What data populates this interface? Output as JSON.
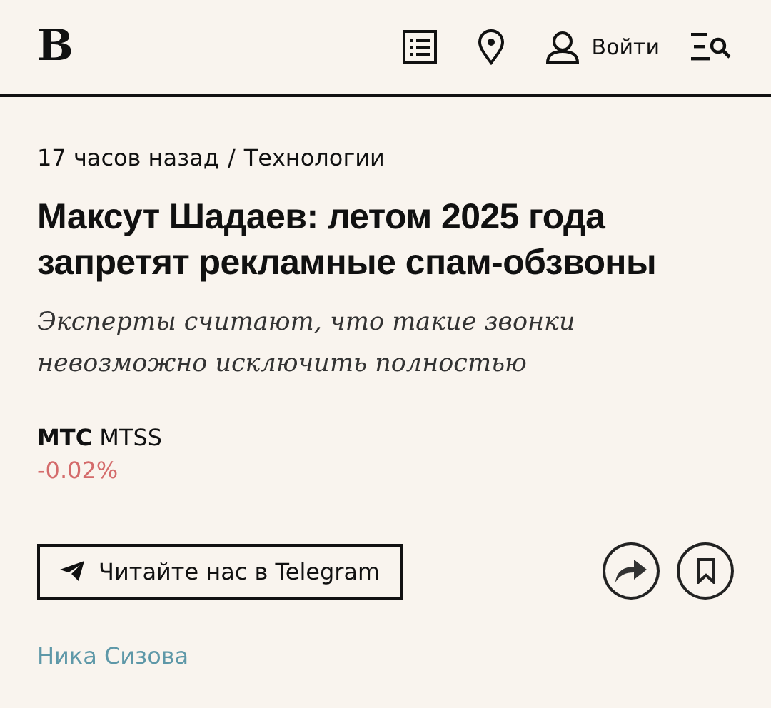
{
  "header": {
    "logo": "В",
    "login": "Войти"
  },
  "article": {
    "time": "17 часов назад",
    "separator": "/",
    "category": "Технологии",
    "title": "Максут Шадаев: летом 2025 года запретят рекламные спам-обзвоны",
    "subtitle": "Эксперты считают, что такие звонки невозможно исключить полностью",
    "ticker": {
      "company": "МТС",
      "symbol": "MTSS",
      "change": "-0.02%"
    },
    "telegram_button": "Читайте нас в Telegram",
    "author": "Ника Сизова"
  }
}
